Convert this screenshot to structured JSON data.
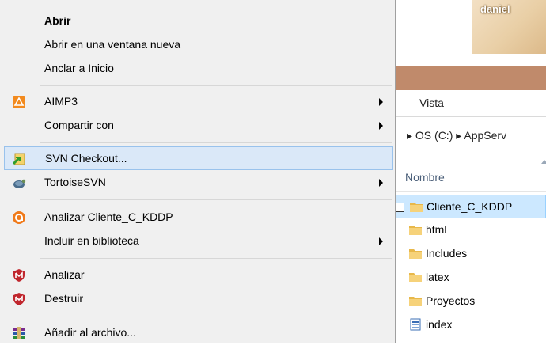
{
  "photo": {
    "label": "daniel"
  },
  "ribbon": {
    "tab_view": "Vista"
  },
  "address": {
    "path": "▸  OS (C:)  ▸  AppServ"
  },
  "file_list": {
    "column_name": "Nombre",
    "items": [
      {
        "name": "Cliente_C_KDDP",
        "icon": "folder-icon",
        "selected": true
      },
      {
        "name": "html",
        "icon": "folder-icon"
      },
      {
        "name": "Includes",
        "icon": "folder-icon"
      },
      {
        "name": "latex",
        "icon": "folder-icon"
      },
      {
        "name": "Proyectos",
        "icon": "folder-icon"
      },
      {
        "name": "index",
        "icon": "document-icon"
      }
    ]
  },
  "menu": {
    "open": "Abrir",
    "open_new_window": "Abrir en una ventana nueva",
    "pin_start": "Anclar a Inicio",
    "aimp3": "AIMP3",
    "share_with": "Compartir con",
    "svn_checkout": "SVN Checkout...",
    "tortoisesvn": "TortoiseSVN",
    "analyze_folder": "Analizar Cliente_C_KDDP",
    "include_library": "Incluir en biblioteca",
    "analyze": "Analizar",
    "destroy": "Destruir",
    "add_archive": "Añadir al archivo..."
  },
  "colors": {
    "menu_bg": "#f0f0f0",
    "hover_bg": "#dae8f8",
    "selection_bg": "#cce8ff",
    "folder": "#e8b84a"
  }
}
